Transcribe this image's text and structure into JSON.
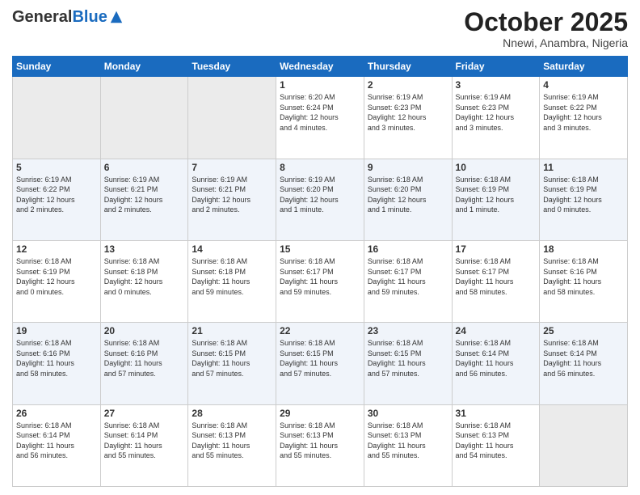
{
  "logo": {
    "general": "General",
    "blue": "Blue"
  },
  "title": "October 2025",
  "subtitle": "Nnewi, Anambra, Nigeria",
  "days_of_week": [
    "Sunday",
    "Monday",
    "Tuesday",
    "Wednesday",
    "Thursday",
    "Friday",
    "Saturday"
  ],
  "weeks": [
    [
      {
        "day": "",
        "info": "",
        "empty": true
      },
      {
        "day": "",
        "info": "",
        "empty": true
      },
      {
        "day": "",
        "info": "",
        "empty": true
      },
      {
        "day": "1",
        "info": "Sunrise: 6:20 AM\nSunset: 6:24 PM\nDaylight: 12 hours\nand 4 minutes."
      },
      {
        "day": "2",
        "info": "Sunrise: 6:19 AM\nSunset: 6:23 PM\nDaylight: 12 hours\nand 3 minutes."
      },
      {
        "day": "3",
        "info": "Sunrise: 6:19 AM\nSunset: 6:23 PM\nDaylight: 12 hours\nand 3 minutes."
      },
      {
        "day": "4",
        "info": "Sunrise: 6:19 AM\nSunset: 6:22 PM\nDaylight: 12 hours\nand 3 minutes."
      }
    ],
    [
      {
        "day": "5",
        "info": "Sunrise: 6:19 AM\nSunset: 6:22 PM\nDaylight: 12 hours\nand 2 minutes."
      },
      {
        "day": "6",
        "info": "Sunrise: 6:19 AM\nSunset: 6:21 PM\nDaylight: 12 hours\nand 2 minutes."
      },
      {
        "day": "7",
        "info": "Sunrise: 6:19 AM\nSunset: 6:21 PM\nDaylight: 12 hours\nand 2 minutes."
      },
      {
        "day": "8",
        "info": "Sunrise: 6:19 AM\nSunset: 6:20 PM\nDaylight: 12 hours\nand 1 minute."
      },
      {
        "day": "9",
        "info": "Sunrise: 6:18 AM\nSunset: 6:20 PM\nDaylight: 12 hours\nand 1 minute."
      },
      {
        "day": "10",
        "info": "Sunrise: 6:18 AM\nSunset: 6:19 PM\nDaylight: 12 hours\nand 1 minute."
      },
      {
        "day": "11",
        "info": "Sunrise: 6:18 AM\nSunset: 6:19 PM\nDaylight: 12 hours\nand 0 minutes."
      }
    ],
    [
      {
        "day": "12",
        "info": "Sunrise: 6:18 AM\nSunset: 6:19 PM\nDaylight: 12 hours\nand 0 minutes."
      },
      {
        "day": "13",
        "info": "Sunrise: 6:18 AM\nSunset: 6:18 PM\nDaylight: 12 hours\nand 0 minutes."
      },
      {
        "day": "14",
        "info": "Sunrise: 6:18 AM\nSunset: 6:18 PM\nDaylight: 11 hours\nand 59 minutes."
      },
      {
        "day": "15",
        "info": "Sunrise: 6:18 AM\nSunset: 6:17 PM\nDaylight: 11 hours\nand 59 minutes."
      },
      {
        "day": "16",
        "info": "Sunrise: 6:18 AM\nSunset: 6:17 PM\nDaylight: 11 hours\nand 59 minutes."
      },
      {
        "day": "17",
        "info": "Sunrise: 6:18 AM\nSunset: 6:17 PM\nDaylight: 11 hours\nand 58 minutes."
      },
      {
        "day": "18",
        "info": "Sunrise: 6:18 AM\nSunset: 6:16 PM\nDaylight: 11 hours\nand 58 minutes."
      }
    ],
    [
      {
        "day": "19",
        "info": "Sunrise: 6:18 AM\nSunset: 6:16 PM\nDaylight: 11 hours\nand 58 minutes."
      },
      {
        "day": "20",
        "info": "Sunrise: 6:18 AM\nSunset: 6:16 PM\nDaylight: 11 hours\nand 57 minutes."
      },
      {
        "day": "21",
        "info": "Sunrise: 6:18 AM\nSunset: 6:15 PM\nDaylight: 11 hours\nand 57 minutes."
      },
      {
        "day": "22",
        "info": "Sunrise: 6:18 AM\nSunset: 6:15 PM\nDaylight: 11 hours\nand 57 minutes."
      },
      {
        "day": "23",
        "info": "Sunrise: 6:18 AM\nSunset: 6:15 PM\nDaylight: 11 hours\nand 57 minutes."
      },
      {
        "day": "24",
        "info": "Sunrise: 6:18 AM\nSunset: 6:14 PM\nDaylight: 11 hours\nand 56 minutes."
      },
      {
        "day": "25",
        "info": "Sunrise: 6:18 AM\nSunset: 6:14 PM\nDaylight: 11 hours\nand 56 minutes."
      }
    ],
    [
      {
        "day": "26",
        "info": "Sunrise: 6:18 AM\nSunset: 6:14 PM\nDaylight: 11 hours\nand 56 minutes."
      },
      {
        "day": "27",
        "info": "Sunrise: 6:18 AM\nSunset: 6:14 PM\nDaylight: 11 hours\nand 55 minutes."
      },
      {
        "day": "28",
        "info": "Sunrise: 6:18 AM\nSunset: 6:13 PM\nDaylight: 11 hours\nand 55 minutes."
      },
      {
        "day": "29",
        "info": "Sunrise: 6:18 AM\nSunset: 6:13 PM\nDaylight: 11 hours\nand 55 minutes."
      },
      {
        "day": "30",
        "info": "Sunrise: 6:18 AM\nSunset: 6:13 PM\nDaylight: 11 hours\nand 55 minutes."
      },
      {
        "day": "31",
        "info": "Sunrise: 6:18 AM\nSunset: 6:13 PM\nDaylight: 11 hours\nand 54 minutes."
      },
      {
        "day": "",
        "info": "",
        "empty": true
      }
    ]
  ]
}
